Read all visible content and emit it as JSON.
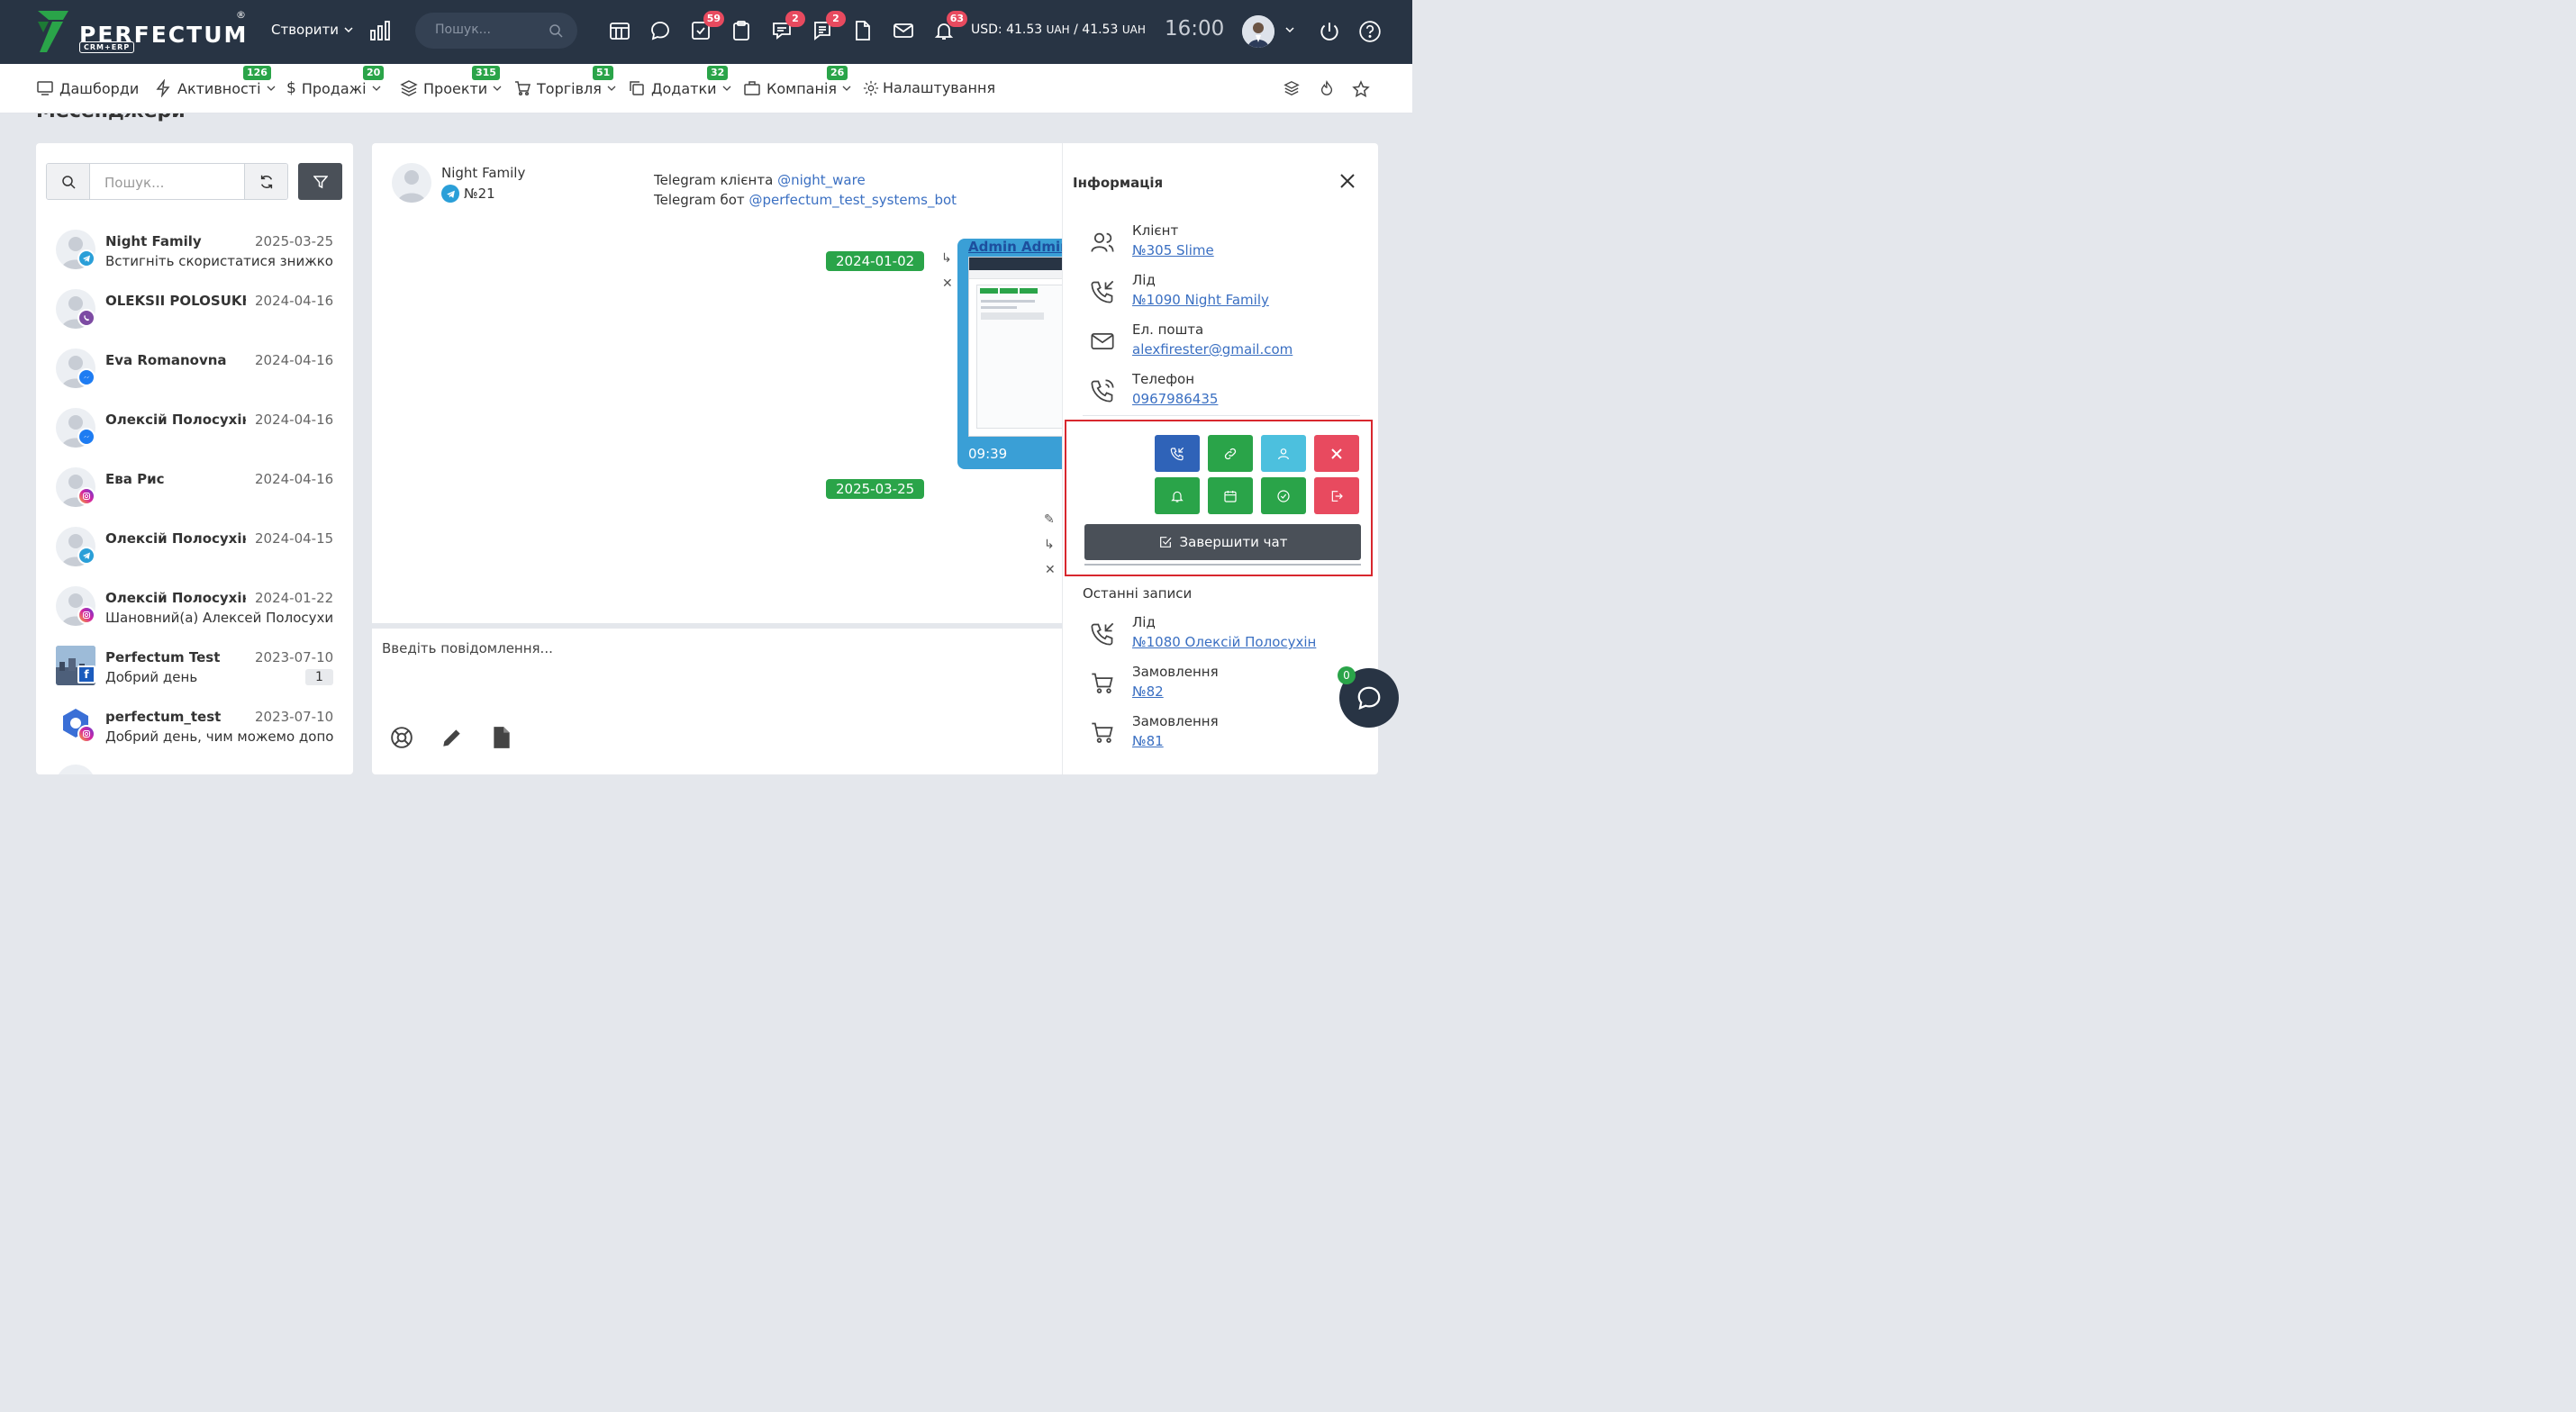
{
  "topbar": {
    "logo_text": "PERFECTUM",
    "logo_reg": "®",
    "logo_sub": "CRM+ERP",
    "create_label": "Створити",
    "search_placeholder": "Пошук...",
    "badges": {
      "tasks": "59",
      "chat": "2",
      "messages": "2",
      "notifications": "63"
    },
    "currency_label": "USD:",
    "currency_val1": "41.53",
    "currency_unit1": "UAH",
    "currency_sep": "/",
    "currency_val2": "41.53",
    "currency_unit2": "UAH",
    "time": "16:00"
  },
  "nav": {
    "items": [
      {
        "label": "Дашборди",
        "badge": ""
      },
      {
        "label": "Активності",
        "badge": "126"
      },
      {
        "label": "Продажі",
        "badge": "20"
      },
      {
        "label": "Проекти",
        "badge": "315"
      },
      {
        "label": "Торгівля",
        "badge": "51"
      },
      {
        "label": "Додатки",
        "badge": "32"
      },
      {
        "label": "Компанія",
        "badge": "26"
      },
      {
        "label": "Налаштування",
        "badge": ""
      }
    ]
  },
  "page_title": "Месенджери",
  "left": {
    "search_placeholder": "Пошук...",
    "conversations": [
      {
        "name": "Night Family",
        "date": "2025-03-25",
        "preview": "Встигніть скористатися знижкою! Г",
        "source": "telegram",
        "count": ""
      },
      {
        "name": "OLEKSII POLOSUKHIN",
        "date": "2024-04-16",
        "preview": "",
        "source": "viber",
        "count": ""
      },
      {
        "name": "Eva Romanovna",
        "date": "2024-04-16",
        "preview": "",
        "source": "messenger",
        "count": ""
      },
      {
        "name": "Олексій Полосухін",
        "date": "2024-04-16",
        "preview": "",
        "source": "messenger",
        "count": ""
      },
      {
        "name": "Ева Рис",
        "date": "2024-04-16",
        "preview": "",
        "source": "instagram",
        "count": ""
      },
      {
        "name": "Олексій Полосухін",
        "date": "2024-04-15",
        "preview": "",
        "source": "telegram",
        "count": ""
      },
      {
        "name": "Олексій Полосухін",
        "date": "2024-01-22",
        "preview": "Шановний(а) Алексей Полосухин, М",
        "source": "instagram",
        "count": ""
      },
      {
        "name": "Perfectum Test",
        "date": "2023-07-10",
        "preview": "Добрий день",
        "source": "facebook",
        "count": "1"
      },
      {
        "name": "perfectum_test",
        "date": "2023-07-10",
        "preview": "Добрий день, чим можемо допомо",
        "source": "instagram",
        "count": ""
      }
    ]
  },
  "chat": {
    "contact_name": "Night Family",
    "contact_id": "№21",
    "tg_client_label": "Telegram клієнта",
    "tg_client_handle": "@night_ware",
    "tg_bot_label": "Telegram бот",
    "tg_bot_handle": "@perfectum_test_systems_bot",
    "date1": "2024-01-02",
    "date2": "2025-03-25",
    "msg_image_caption": "Admin Admin",
    "msg_time": "09:39",
    "input_placeholder": "Введіть повідомлення..."
  },
  "info": {
    "title": "Інформація",
    "client_label": "Клієнт",
    "client_link": "№305 Slime",
    "lead_label": "Лід",
    "lead_link": "№1090 Night Family",
    "email_label": "Ел. пошта",
    "email_link": "alexfirester@gmail.com",
    "phone_label": "Телефон",
    "phone_link": "0967986435",
    "end_chat_label": "Завершити чат",
    "recent_title": "Останні записи",
    "recent": [
      {
        "label": "Лід",
        "link": "№1080 Олексій Полосухін"
      },
      {
        "label": "Замовлення",
        "link": "№82"
      },
      {
        "label": "Замовлення",
        "link": "№81"
      }
    ]
  },
  "floating": {
    "badge": "0"
  },
  "colors": {
    "topbar": "#283444",
    "green": "#2aa449",
    "blue_btn": "#2f63b8",
    "cyan_btn": "#4cc0de",
    "red_btn": "#e84a5f",
    "dark_btn": "#4a5058",
    "link": "#3a6fc2",
    "highlight_frame": "#d8272e"
  }
}
